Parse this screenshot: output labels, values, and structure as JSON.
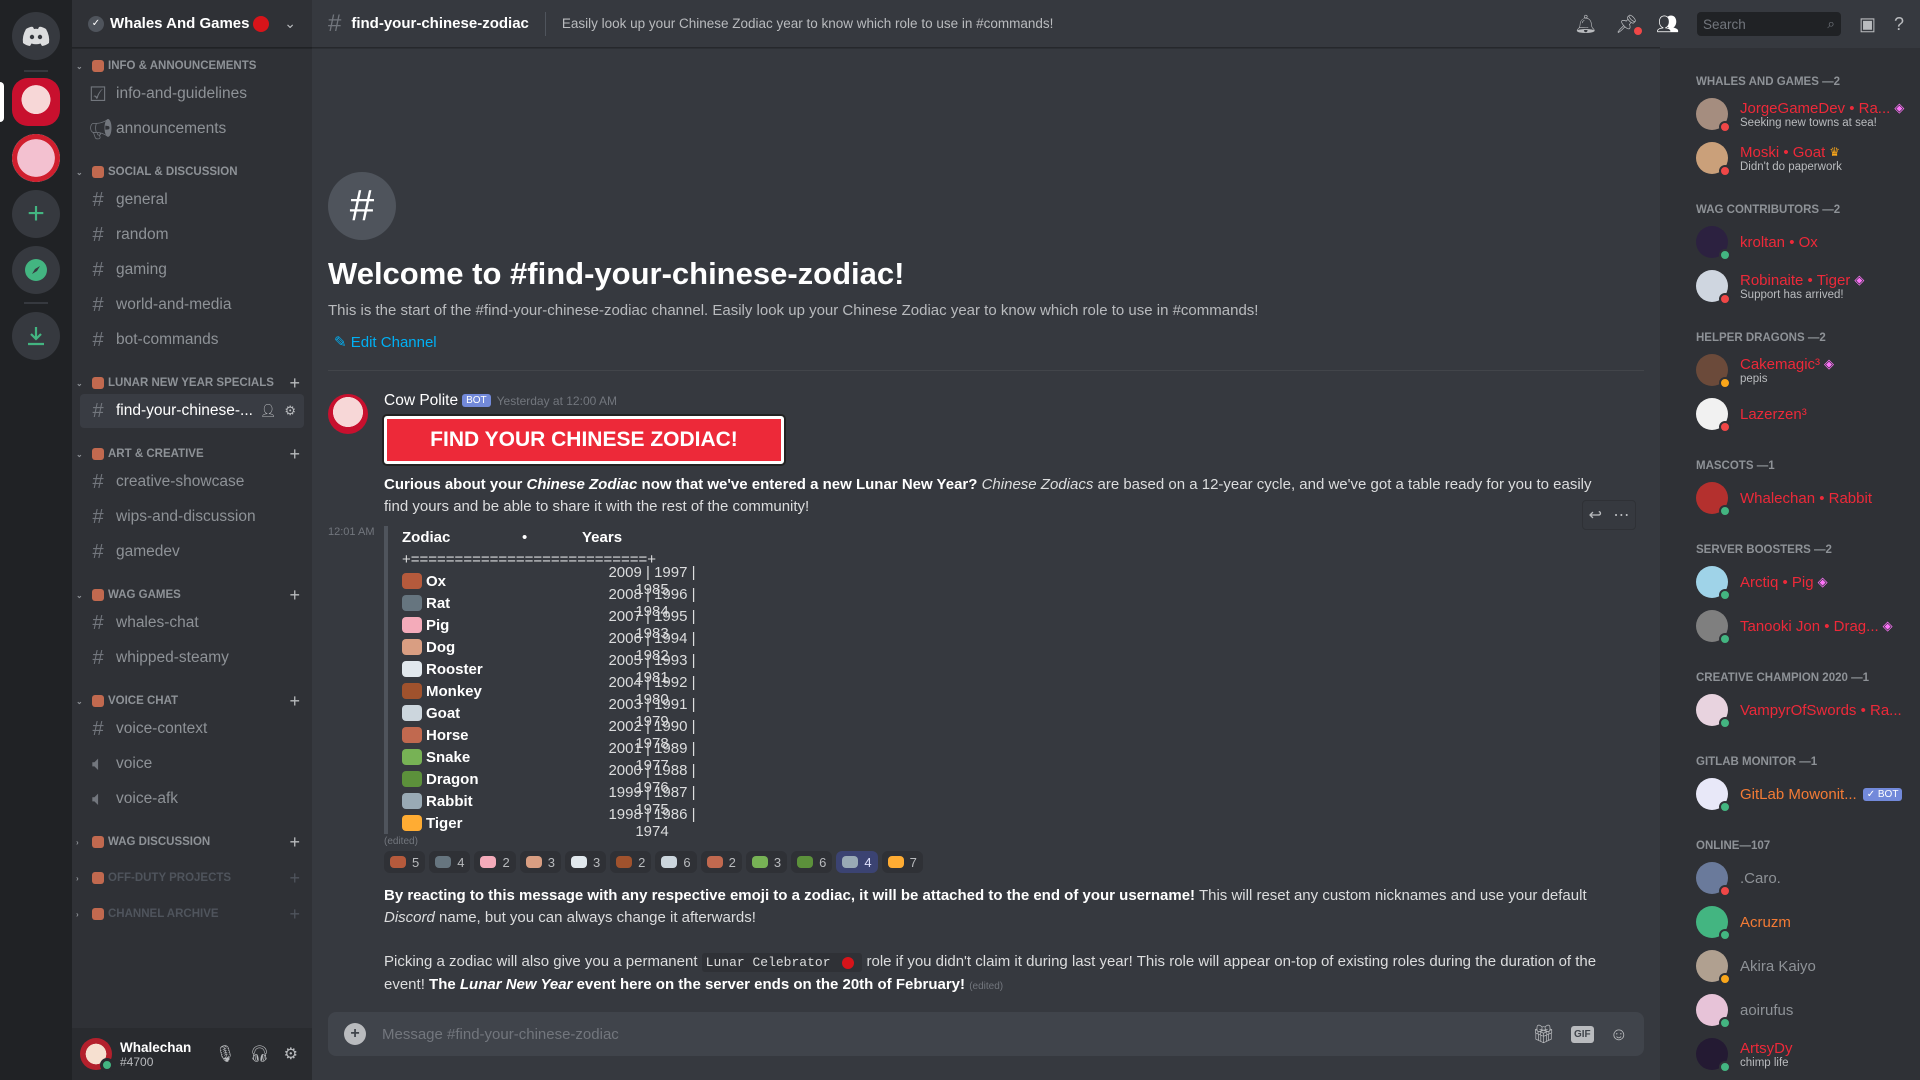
{
  "server": {
    "name": "Whales And Games"
  },
  "sidebar": {
    "categories": [
      {
        "name": "INFO & ANNOUNCEMENTS",
        "collapsed": false,
        "channels": [
          {
            "name": "info-and-guidelines",
            "icon": "rules-icon"
          },
          {
            "name": "announcements",
            "icon": "megaphone-icon"
          }
        ]
      },
      {
        "name": "SOCIAL & DISCUSSION",
        "collapsed": false,
        "channels": [
          {
            "name": "general",
            "icon": "hash-icon"
          },
          {
            "name": "random",
            "icon": "hash-icon"
          },
          {
            "name": "gaming",
            "icon": "hash-icon"
          },
          {
            "name": "world-and-media",
            "icon": "hash-icon"
          },
          {
            "name": "bot-commands",
            "icon": "hash-icon"
          }
        ]
      },
      {
        "name": "LUNAR NEW YEAR SPECIALS",
        "collapsed": false,
        "channels": [
          {
            "name": "find-your-chinese-...",
            "icon": "hash-icon",
            "active": true
          }
        ]
      },
      {
        "name": "ART & CREATIVE",
        "collapsed": false,
        "channels": [
          {
            "name": "creative-showcase",
            "icon": "hash-icon"
          },
          {
            "name": "wips-and-discussion",
            "icon": "hash-icon"
          },
          {
            "name": "gamedev",
            "icon": "hash-icon"
          }
        ]
      },
      {
        "name": "WAG GAMES",
        "collapsed": false,
        "channels": [
          {
            "name": "whales-chat",
            "icon": "hash-icon"
          },
          {
            "name": "whipped-steamy",
            "icon": "nsfw-hash-icon"
          }
        ]
      },
      {
        "name": "VOICE CHAT",
        "collapsed": false,
        "channels": [
          {
            "name": "voice-context",
            "icon": "hash-icon"
          },
          {
            "name": "voice",
            "icon": "speaker-icon"
          },
          {
            "name": "voice-afk",
            "icon": "speaker-icon"
          }
        ]
      },
      {
        "name": "WAG DISCUSSION",
        "collapsed": true,
        "channels": []
      },
      {
        "name": "OFF-DUTY PROJECTS",
        "collapsed": true,
        "dim": true,
        "channels": []
      },
      {
        "name": "CHANNEL ARCHIVE",
        "collapsed": true,
        "dim": true,
        "channels": []
      }
    ]
  },
  "user": {
    "name": "Whalechan",
    "tag": "#4700",
    "status": "online"
  },
  "header": {
    "channel": "find-your-chinese-zodiac",
    "topic": "Easily look up your Chinese Zodiac year to know which role to use in #commands!",
    "search_placeholder": "Search"
  },
  "welcome": {
    "title": "Welcome to #find-your-chinese-zodiac!",
    "desc": "This is the start of the #find-your-chinese-zodiac channel. Easily look up your Chinese Zodiac year to know which role to use in #commands!",
    "edit": "Edit Channel"
  },
  "message": {
    "author": "Cow Polite",
    "badge": "BOT",
    "timestamp": "Yesterday at 12:00 AM",
    "banner": "FIND YOUR CHINESE ZODIAC!",
    "intro_bold1": "Curious about your ",
    "intro_it1": "Chinese Zodiac",
    "intro_bold2": " now that we've entered a new Lunar New Year?",
    "intro_it2": " Chinese Zodiacs",
    "intro_rest": " are based on a 12-year cycle, and we've got a table ready for you to easily find yours and be able to share it with the rest of the community!",
    "side_ts": "12:01 AM",
    "table_head": {
      "zodiac": "Zodiac",
      "dot": "•",
      "years": "Years"
    },
    "table_rule": "+===========================+",
    "table": [
      {
        "name": "Ox",
        "years": "2009 | 1997 | 1985",
        "color": "#b55a3c"
      },
      {
        "name": "Rat",
        "years": "2008 | 1996 | 1984",
        "color": "#66757f"
      },
      {
        "name": "Pig",
        "years": "2007 | 1995 | 1983",
        "color": "#f4abba"
      },
      {
        "name": "Dog",
        "years": "2006 | 1994 | 1982",
        "color": "#d99e82"
      },
      {
        "name": "Rooster",
        "years": "2005 | 1993 | 1981",
        "color": "#e1e8ed"
      },
      {
        "name": "Monkey",
        "years": "2004 | 1992 | 1980",
        "color": "#a0522d"
      },
      {
        "name": "Goat",
        "years": "2003 | 1991 | 1979",
        "color": "#ccd6dd"
      },
      {
        "name": "Horse",
        "years": "2002 | 1990 | 1978",
        "color": "#c1694f"
      },
      {
        "name": "Snake",
        "years": "2001 | 1989 | 1977",
        "color": "#77b255"
      },
      {
        "name": "Dragon",
        "years": "2000 | 1988 | 1976",
        "color": "#5c913b"
      },
      {
        "name": "Rabbit",
        "years": "1999 | 1987 | 1975",
        "color": "#99aab5"
      },
      {
        "name": "Tiger",
        "years": "1998 | 1986 | 1974",
        "color": "#ffac33"
      }
    ],
    "edited": "(edited)",
    "reactions": [
      {
        "emoji": "ox",
        "count": "5",
        "color": "#b55a3c"
      },
      {
        "emoji": "rat",
        "count": "4",
        "color": "#66757f"
      },
      {
        "emoji": "pig",
        "count": "2",
        "color": "#f4abba"
      },
      {
        "emoji": "dog",
        "count": "3",
        "color": "#d99e82"
      },
      {
        "emoji": "rooster",
        "count": "3",
        "color": "#e1e8ed"
      },
      {
        "emoji": "monkey",
        "count": "2",
        "color": "#a0522d"
      },
      {
        "emoji": "goat",
        "count": "6",
        "color": "#ccd6dd"
      },
      {
        "emoji": "horse",
        "count": "2",
        "color": "#c1694f"
      },
      {
        "emoji": "snake",
        "count": "3",
        "color": "#77b255"
      },
      {
        "emoji": "dragon",
        "count": "6",
        "color": "#5c913b"
      },
      {
        "emoji": "rabbit",
        "count": "4",
        "color": "#99aab5",
        "me": true
      },
      {
        "emoji": "tiger",
        "count": "7",
        "color": "#ffac33"
      }
    ],
    "p2_bold": "By reacting to this message with any respective emoji to a zodiac, it will be attached to the end of your username!",
    "p2_rest1": " This will reset any custom nicknames and use your default ",
    "p2_it": "Discord",
    "p2_rest2": " name, but you can always change it afterwards!",
    "p3_a": "Picking a zodiac will also give you a permanent ",
    "p3_code": "Lunar Celebrator",
    "p3_b": " role if you didn't claim it during last year! This role will appear on-top of existing roles during the duration of the event! ",
    "p3_bold1": "The ",
    "p3_boldit": "Lunar New Year",
    "p3_bold2": " event here on the server ends on the 20th of February!",
    "p3_edited": "(edited)"
  },
  "composer": {
    "placeholder": "Message #find-your-chinese-zodiac",
    "gif": "GIF"
  },
  "members": {
    "groups": [
      {
        "title": "WHALES AND GAMES —2",
        "members": [
          {
            "name": "JorgeGameDev • Ra...",
            "sub": "Seeking new towns at sea!",
            "status": "dnd",
            "color": "red",
            "boost": true
          },
          {
            "name": "Moski • Goat",
            "sub": "Didn't do paperwork",
            "status": "dnd",
            "color": "red",
            "owner": true
          }
        ]
      },
      {
        "title": "WAG CONTRIBUTORS —2",
        "members": [
          {
            "name": "kroltan • Ox",
            "sub": "",
            "status": "on",
            "color": "red"
          },
          {
            "name": "Robinaite • Tiger",
            "sub": "Support has arrived!",
            "status": "dnd",
            "color": "red",
            "boost": true
          }
        ]
      },
      {
        "title": "HELPER DRAGONS —2",
        "members": [
          {
            "name": "Cakemagic³",
            "sub": "pepis",
            "status": "idle",
            "color": "red",
            "boost": true
          },
          {
            "name": "Lazerzen³",
            "sub": "",
            "status": "dnd",
            "color": "red"
          }
        ]
      },
      {
        "title": "MASCOTS —1",
        "members": [
          {
            "name": "Whalechan • Rabbit",
            "sub": "",
            "status": "on",
            "color": "red"
          }
        ]
      },
      {
        "title": "SERVER BOOSTERS —2",
        "members": [
          {
            "name": "Arctiq • Pig",
            "sub": "",
            "status": "on",
            "color": "red",
            "boost": true
          },
          {
            "name": "Tanooki Jon • Drag...",
            "sub": "",
            "status": "on",
            "color": "red",
            "boost": true
          }
        ]
      },
      {
        "title": "CREATIVE CHAMPION 2020 —1",
        "members": [
          {
            "name": "VampyrOfSwords • Ra...",
            "sub": "",
            "status": "on",
            "color": "red"
          }
        ]
      },
      {
        "title": "GITLAB MONITOR —1",
        "members": [
          {
            "name": "GitLab Mowonit...",
            "sub": "",
            "status": "on",
            "color": "orange",
            "bot": "✓ BOT"
          }
        ]
      },
      {
        "title": "ONLINE—107",
        "members": [
          {
            "name": ".Caro.",
            "sub": "",
            "status": "dnd",
            "color": "grey"
          },
          {
            "name": "Acruzm",
            "sub": "",
            "status": "on",
            "color": "orange"
          },
          {
            "name": "Akira Kaiyo",
            "sub": "",
            "status": "idle",
            "color": "grey"
          },
          {
            "name": "aoirufus",
            "sub": "",
            "status": "on",
            "color": "grey"
          },
          {
            "name": "ArtsyDy",
            "sub": "chimp life",
            "status": "on",
            "color": "red"
          }
        ]
      }
    ]
  },
  "colors": {
    "accent": "#7289da",
    "online": "#43b581",
    "dnd": "#f04747",
    "idle": "#faa61a",
    "link": "#00b0f4",
    "role_red": "#ed2939"
  }
}
